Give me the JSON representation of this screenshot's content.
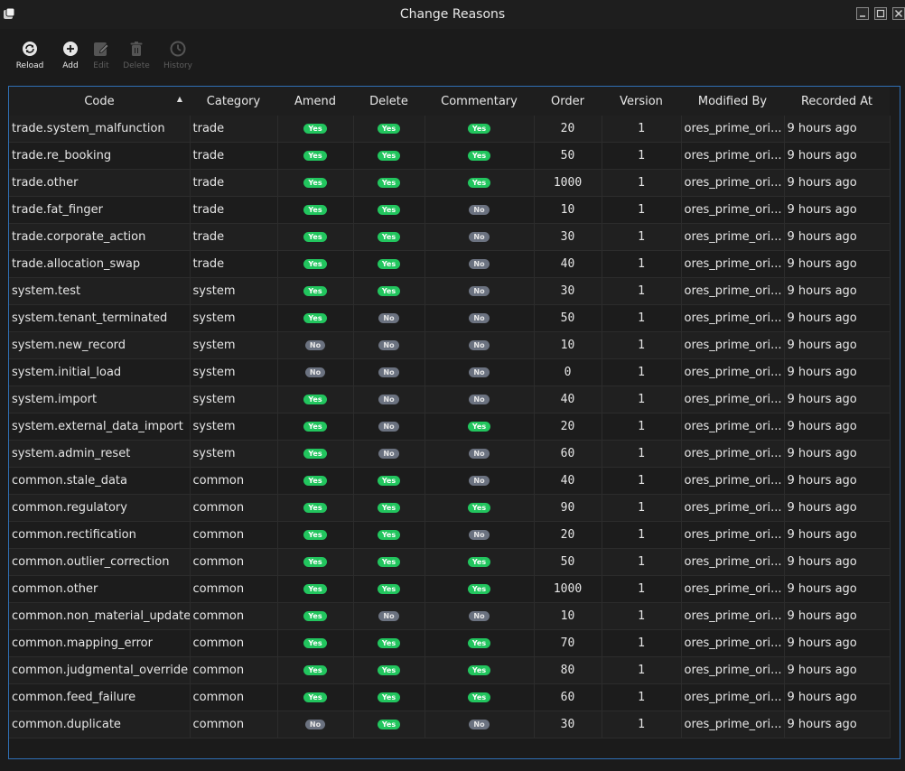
{
  "window": {
    "title": "Change Reasons"
  },
  "toolbar": {
    "reload": "Reload",
    "add": "Add",
    "edit": "Edit",
    "delete": "Delete",
    "history": "History"
  },
  "columns": [
    "Code",
    "Category",
    "Amend",
    "Delete",
    "Commentary",
    "Order",
    "Version",
    "Modified By",
    "Recorded At"
  ],
  "sort": {
    "column": "Code",
    "direction": "ascending"
  },
  "colors": {
    "yes_badge": "#22c55e",
    "no_badge": "#6b7280",
    "selection_border": "#2f6fb5"
  },
  "rows": [
    {
      "code": "trade.system_malfunction",
      "category": "trade",
      "amend": "Yes",
      "delete": "Yes",
      "commentary": "Yes",
      "order": "20",
      "version": "1",
      "modified_by": "ores_prime_ori...",
      "recorded_at": "9 hours ago"
    },
    {
      "code": "trade.re_booking",
      "category": "trade",
      "amend": "Yes",
      "delete": "Yes",
      "commentary": "Yes",
      "order": "50",
      "version": "1",
      "modified_by": "ores_prime_ori...",
      "recorded_at": "9 hours ago"
    },
    {
      "code": "trade.other",
      "category": "trade",
      "amend": "Yes",
      "delete": "Yes",
      "commentary": "Yes",
      "order": "1000",
      "version": "1",
      "modified_by": "ores_prime_ori...",
      "recorded_at": "9 hours ago"
    },
    {
      "code": "trade.fat_finger",
      "category": "trade",
      "amend": "Yes",
      "delete": "Yes",
      "commentary": "No",
      "order": "10",
      "version": "1",
      "modified_by": "ores_prime_ori...",
      "recorded_at": "9 hours ago"
    },
    {
      "code": "trade.corporate_action",
      "category": "trade",
      "amend": "Yes",
      "delete": "Yes",
      "commentary": "No",
      "order": "30",
      "version": "1",
      "modified_by": "ores_prime_ori...",
      "recorded_at": "9 hours ago"
    },
    {
      "code": "trade.allocation_swap",
      "category": "trade",
      "amend": "Yes",
      "delete": "Yes",
      "commentary": "No",
      "order": "40",
      "version": "1",
      "modified_by": "ores_prime_ori...",
      "recorded_at": "9 hours ago"
    },
    {
      "code": "system.test",
      "category": "system",
      "amend": "Yes",
      "delete": "Yes",
      "commentary": "No",
      "order": "30",
      "version": "1",
      "modified_by": "ores_prime_ori...",
      "recorded_at": "9 hours ago"
    },
    {
      "code": "system.tenant_terminated",
      "category": "system",
      "amend": "Yes",
      "delete": "No",
      "commentary": "No",
      "order": "50",
      "version": "1",
      "modified_by": "ores_prime_ori...",
      "recorded_at": "9 hours ago"
    },
    {
      "code": "system.new_record",
      "category": "system",
      "amend": "No",
      "delete": "No",
      "commentary": "No",
      "order": "10",
      "version": "1",
      "modified_by": "ores_prime_ori...",
      "recorded_at": "9 hours ago"
    },
    {
      "code": "system.initial_load",
      "category": "system",
      "amend": "No",
      "delete": "No",
      "commentary": "No",
      "order": "0",
      "version": "1",
      "modified_by": "ores_prime_ori...",
      "recorded_at": "9 hours ago"
    },
    {
      "code": "system.import",
      "category": "system",
      "amend": "Yes",
      "delete": "No",
      "commentary": "No",
      "order": "40",
      "version": "1",
      "modified_by": "ores_prime_ori...",
      "recorded_at": "9 hours ago"
    },
    {
      "code": "system.external_data_import",
      "category": "system",
      "amend": "Yes",
      "delete": "No",
      "commentary": "Yes",
      "order": "20",
      "version": "1",
      "modified_by": "ores_prime_ori...",
      "recorded_at": "9 hours ago"
    },
    {
      "code": "system.admin_reset",
      "category": "system",
      "amend": "Yes",
      "delete": "No",
      "commentary": "No",
      "order": "60",
      "version": "1",
      "modified_by": "ores_prime_ori...",
      "recorded_at": "9 hours ago"
    },
    {
      "code": "common.stale_data",
      "category": "common",
      "amend": "Yes",
      "delete": "Yes",
      "commentary": "No",
      "order": "40",
      "version": "1",
      "modified_by": "ores_prime_ori...",
      "recorded_at": "9 hours ago"
    },
    {
      "code": "common.regulatory",
      "category": "common",
      "amend": "Yes",
      "delete": "Yes",
      "commentary": "Yes",
      "order": "90",
      "version": "1",
      "modified_by": "ores_prime_ori...",
      "recorded_at": "9 hours ago"
    },
    {
      "code": "common.rectification",
      "category": "common",
      "amend": "Yes",
      "delete": "Yes",
      "commentary": "No",
      "order": "20",
      "version": "1",
      "modified_by": "ores_prime_ori...",
      "recorded_at": "9 hours ago"
    },
    {
      "code": "common.outlier_correction",
      "category": "common",
      "amend": "Yes",
      "delete": "Yes",
      "commentary": "Yes",
      "order": "50",
      "version": "1",
      "modified_by": "ores_prime_ori...",
      "recorded_at": "9 hours ago"
    },
    {
      "code": "common.other",
      "category": "common",
      "amend": "Yes",
      "delete": "Yes",
      "commentary": "Yes",
      "order": "1000",
      "version": "1",
      "modified_by": "ores_prime_ori...",
      "recorded_at": "9 hours ago"
    },
    {
      "code": "common.non_material_update",
      "category": "common",
      "amend": "Yes",
      "delete": "No",
      "commentary": "No",
      "order": "10",
      "version": "1",
      "modified_by": "ores_prime_ori...",
      "recorded_at": "9 hours ago"
    },
    {
      "code": "common.mapping_error",
      "category": "common",
      "amend": "Yes",
      "delete": "Yes",
      "commentary": "Yes",
      "order": "70",
      "version": "1",
      "modified_by": "ores_prime_ori...",
      "recorded_at": "9 hours ago"
    },
    {
      "code": "common.judgmental_override",
      "category": "common",
      "amend": "Yes",
      "delete": "Yes",
      "commentary": "Yes",
      "order": "80",
      "version": "1",
      "modified_by": "ores_prime_ori...",
      "recorded_at": "9 hours ago"
    },
    {
      "code": "common.feed_failure",
      "category": "common",
      "amend": "Yes",
      "delete": "Yes",
      "commentary": "Yes",
      "order": "60",
      "version": "1",
      "modified_by": "ores_prime_ori...",
      "recorded_at": "9 hours ago"
    },
    {
      "code": "common.duplicate",
      "category": "common",
      "amend": "No",
      "delete": "Yes",
      "commentary": "No",
      "order": "30",
      "version": "1",
      "modified_by": "ores_prime_ori...",
      "recorded_at": "9 hours ago"
    }
  ]
}
